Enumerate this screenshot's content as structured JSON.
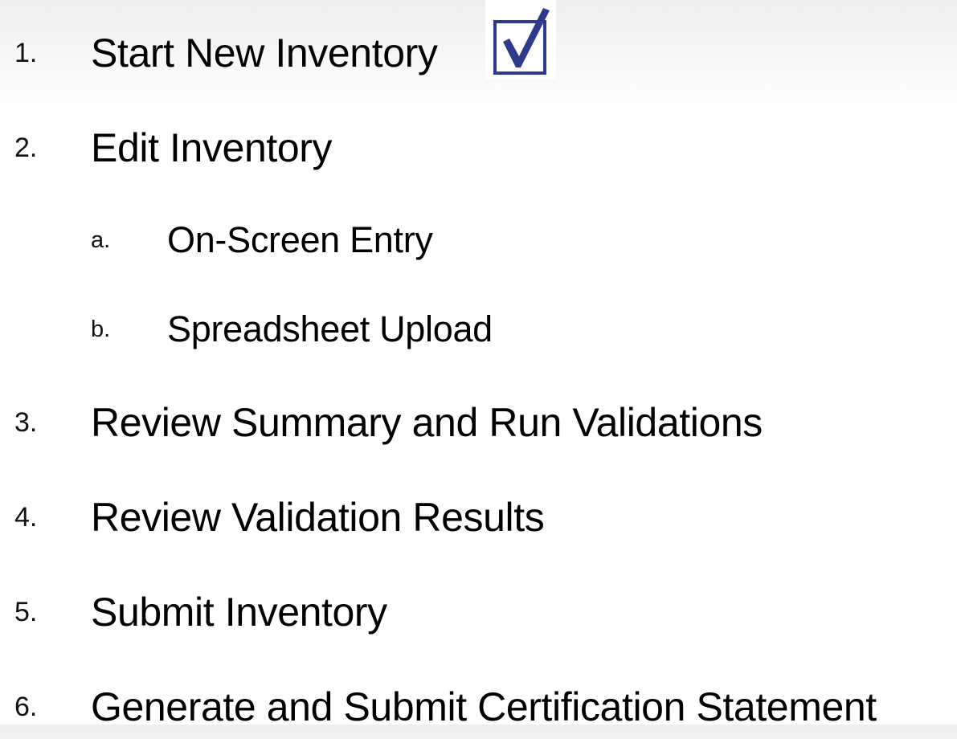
{
  "steps": [
    {
      "number": "1.",
      "label": "Start New Inventory",
      "completed": true,
      "icon": "checkbox-checked-icon"
    },
    {
      "number": "2.",
      "label": "Edit Inventory"
    },
    {
      "number": "a.",
      "label": "On-Screen Entry"
    },
    {
      "number": "b.",
      "label": "Spreadsheet Upload"
    },
    {
      "number": "3.",
      "label": "Review Summary and Run Validations"
    },
    {
      "number": "4.",
      "label": "Review Validation Results"
    },
    {
      "number": "5.",
      "label": "Submit Inventory"
    },
    {
      "number": "6.",
      "label": "Generate and Submit Certification Statement"
    }
  ],
  "colors": {
    "checkbox_border": "#2e3a8c",
    "checkmark": "#2e3a8c"
  }
}
